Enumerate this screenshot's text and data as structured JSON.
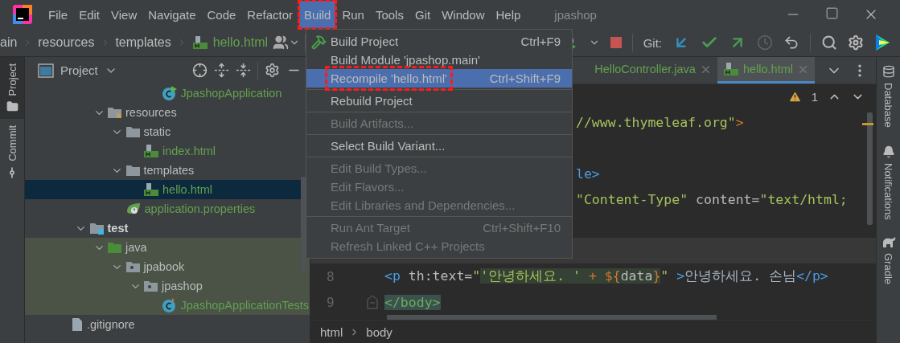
{
  "window": {
    "title": "jpashop"
  },
  "menu_bar": [
    {
      "label": "File",
      "selected": false,
      "annotated": false
    },
    {
      "label": "Edit",
      "selected": false,
      "annotated": false
    },
    {
      "label": "View",
      "selected": false,
      "annotated": false
    },
    {
      "label": "Navigate",
      "selected": false,
      "annotated": false
    },
    {
      "label": "Code",
      "selected": false,
      "annotated": false
    },
    {
      "label": "Refactor",
      "selected": false,
      "annotated": false
    },
    {
      "label": "Build",
      "selected": true,
      "annotated": true
    },
    {
      "label": "Run",
      "selected": false,
      "annotated": false
    },
    {
      "label": "Tools",
      "selected": false,
      "annotated": false
    },
    {
      "label": "Git",
      "selected": false,
      "annotated": false
    },
    {
      "label": "Window",
      "selected": false,
      "annotated": false
    },
    {
      "label": "Help",
      "selected": false,
      "annotated": false
    }
  ],
  "breadcrumbs": [
    {
      "label": "ain",
      "kind": "dir"
    },
    {
      "label": "resources",
      "kind": "dir"
    },
    {
      "label": "templates",
      "kind": "dir"
    },
    {
      "label": "hello.html",
      "kind": "html"
    }
  ],
  "toolbar": {
    "git_label": "Git:"
  },
  "left_tool_windows": [
    {
      "label": "Project",
      "selected": true
    },
    {
      "label": "Commit",
      "selected": false
    }
  ],
  "project_panel": {
    "title": "Project",
    "tree": [
      {
        "children": [
          {
            "children": [
              {
                "children": [
                  {
                    "children": [
                      {
                        "children": [
                          {
                            "label": "JpashopApplication",
                            "kind": "spring-class",
                            "color": "#62a14f",
                            "selected": false,
                            "highlighted": false
                          }
                        ]
                      }
                    ]
                  }
                ]
              },
              {
                "label": "resources",
                "kind": "resources-folder",
                "color": "#bbbbbb",
                "expanded": true,
                "selected": false,
                "highlighted": false,
                "children": [
                  {
                    "label": "static",
                    "kind": "folder",
                    "color": "#bbbbbb",
                    "expanded": true,
                    "selected": false,
                    "highlighted": false,
                    "children": [
                      {
                        "label": "index.html",
                        "kind": "html",
                        "color": "#62a14f",
                        "selected": false,
                        "highlighted": false
                      }
                    ]
                  },
                  {
                    "label": "templates",
                    "kind": "folder",
                    "color": "#bbbbbb",
                    "expanded": true,
                    "selected": false,
                    "highlighted": false,
                    "children": [
                      {
                        "label": "hello.html",
                        "kind": "html",
                        "color": "#62a14f",
                        "selected": true,
                        "highlighted": false
                      }
                    ]
                  },
                  {
                    "label": "application.properties",
                    "kind": "properties",
                    "color": "#62a14f",
                    "selected": false,
                    "highlighted": false
                  }
                ]
              }
            ]
          },
          {
            "label": "test",
            "kind": "test-root",
            "color": "#d4d4d4",
            "expanded": true,
            "selected": false,
            "highlighted": false,
            "children": [
              {
                "label": "java",
                "kind": "test-sources",
                "color": "#bbbbbb",
                "expanded": true,
                "selected": false,
                "highlighted": true,
                "children": [
                  {
                    "label": "jpabook",
                    "kind": "package",
                    "color": "#bbbbbb",
                    "expanded": true,
                    "selected": false,
                    "highlighted": true,
                    "children": [
                      {
                        "label": "jpashop",
                        "kind": "package",
                        "color": "#bbbbbb",
                        "expanded": true,
                        "selected": false,
                        "highlighted": true,
                        "children": [
                          {
                            "label": "JpashopApplicationTests",
                            "kind": "test-class",
                            "color": "#62a14f",
                            "selected": false,
                            "highlighted": true
                          }
                        ]
                      }
                    ]
                  }
                ]
              }
            ]
          }
        ]
      },
      {
        "label": ".gitignore",
        "kind": "gitignore",
        "color": "#bbbbbb",
        "selected": false,
        "highlighted": false
      }
    ]
  },
  "editor": {
    "tabs": [
      {
        "label": "HelloController.java",
        "selected": false
      },
      {
        "label": "hello.html",
        "selected": true
      }
    ],
    "warning_count": "1",
    "lines": [
      {
        "current": false,
        "segments": [
          {
            "kind": "string",
            "text": "//www.thymeleaf.org\"",
            "embedded": false
          },
          {
            "kind": "keyword",
            "text": ">",
            "embedded": false
          }
        ]
      },
      {
        "current": false
      },
      {
        "current": false,
        "segments": [
          {
            "kind": "tag",
            "text": "le>",
            "embedded": false
          }
        ]
      },
      {
        "current": false,
        "segments": [
          {
            "kind": "string",
            "text": "\"Content-Type\"",
            "embedded": false
          },
          {
            "kind": "attr",
            "text": " content=",
            "embedded": false
          },
          {
            "kind": "string",
            "text": "\"text/html;",
            "embedded": false
          }
        ]
      },
      {
        "current": false
      },
      {
        "current": true
      },
      {
        "current": false,
        "number": "8",
        "segments": [
          {
            "kind": "tag",
            "text": "<p",
            "embedded": false
          },
          {
            "kind": "attr",
            "text": " th:text=",
            "embedded": false
          },
          {
            "kind": "string",
            "text": "\"",
            "embedded": false
          },
          {
            "kind": "string",
            "text": "'안녕하세요. '",
            "embedded": true
          },
          {
            "kind": "keyword",
            "text": " + ${",
            "embedded": true
          },
          {
            "kind": "attr",
            "text": "data",
            "embedded": true
          },
          {
            "kind": "keyword",
            "text": "}",
            "embedded": true
          },
          {
            "kind": "string",
            "text": "\" ",
            "embedded": false
          },
          {
            "kind": "tag",
            "text": ">",
            "embedded": false
          },
          {
            "kind": "text",
            "text": "안녕하세요. 손님",
            "embedded": false
          },
          {
            "kind": "tag",
            "text": "</p>",
            "embedded": false
          }
        ]
      },
      {
        "current": false,
        "number": "9",
        "segments": [
          {
            "kind": "match",
            "text": "</body>",
            "embedded": false
          }
        ]
      }
    ],
    "path": [
      "html",
      "body"
    ]
  },
  "right_tool_windows": [
    {
      "label": "Database"
    },
    {
      "label": "Notifications"
    },
    {
      "label": "Gradle"
    }
  ],
  "build_menu": [
    {
      "kind": "item",
      "label": "Build Project",
      "shortcut": "Ctrl+F9",
      "disabled": false,
      "selected": false,
      "annotated": false
    },
    {
      "kind": "item",
      "label": "Build Module 'jpashop.main'",
      "disabled": false,
      "selected": false,
      "annotated": false
    },
    {
      "kind": "item",
      "label": "Recompile 'hello.html'",
      "shortcut": "Ctrl+Shift+F9",
      "disabled": false,
      "selected": true,
      "annotated": true
    },
    {
      "kind": "separator"
    },
    {
      "kind": "item",
      "label": "Rebuild Project",
      "disabled": false,
      "selected": false,
      "annotated": false
    },
    {
      "kind": "separator"
    },
    {
      "kind": "item",
      "label": "Build Artifacts...",
      "disabled": true,
      "selected": false,
      "annotated": false
    },
    {
      "kind": "separator"
    },
    {
      "kind": "item",
      "label": "Select Build Variant...",
      "disabled": false,
      "selected": false,
      "annotated": false
    },
    {
      "kind": "separator"
    },
    {
      "kind": "item",
      "label": "Edit Build Types...",
      "disabled": true,
      "selected": false,
      "annotated": false
    },
    {
      "kind": "item",
      "label": "Edit Flavors...",
      "disabled": true,
      "selected": false,
      "annotated": false
    },
    {
      "kind": "item",
      "label": "Edit Libraries and Dependencies...",
      "disabled": true,
      "selected": false,
      "annotated": false
    },
    {
      "kind": "separator"
    },
    {
      "kind": "item",
      "label": "Run Ant Target",
      "shortcut": "Ctrl+Shift+F10",
      "disabled": true,
      "selected": false,
      "annotated": false
    },
    {
      "kind": "item",
      "label": "Refresh Linked C++ Projects",
      "disabled": true,
      "selected": false,
      "annotated": false
    }
  ]
}
